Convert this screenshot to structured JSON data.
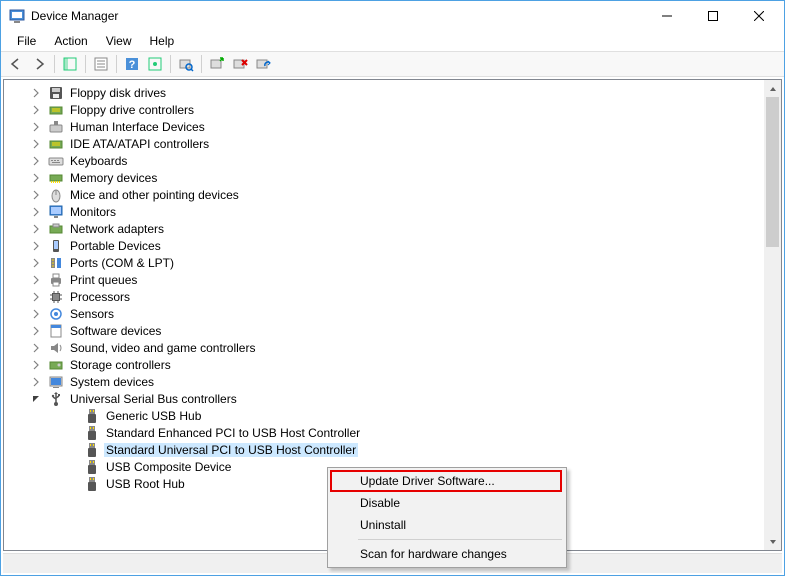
{
  "window": {
    "title": "Device Manager"
  },
  "menu": {
    "file": "File",
    "action": "Action",
    "view": "View",
    "help": "Help"
  },
  "tree": {
    "categories": [
      {
        "label": "Floppy disk drives",
        "expanded": false
      },
      {
        "label": "Floppy drive controllers",
        "expanded": false
      },
      {
        "label": "Human Interface Devices",
        "expanded": false
      },
      {
        "label": "IDE ATA/ATAPI controllers",
        "expanded": false
      },
      {
        "label": "Keyboards",
        "expanded": false
      },
      {
        "label": "Memory devices",
        "expanded": false
      },
      {
        "label": "Mice and other pointing devices",
        "expanded": false
      },
      {
        "label": "Monitors",
        "expanded": false
      },
      {
        "label": "Network adapters",
        "expanded": false
      },
      {
        "label": "Portable Devices",
        "expanded": false
      },
      {
        "label": "Ports (COM & LPT)",
        "expanded": false
      },
      {
        "label": "Print queues",
        "expanded": false
      },
      {
        "label": "Processors",
        "expanded": false
      },
      {
        "label": "Sensors",
        "expanded": false
      },
      {
        "label": "Software devices",
        "expanded": false
      },
      {
        "label": "Sound, video and game controllers",
        "expanded": false
      },
      {
        "label": "Storage controllers",
        "expanded": false
      },
      {
        "label": "System devices",
        "expanded": false
      },
      {
        "label": "Universal Serial Bus controllers",
        "expanded": true
      }
    ],
    "usb_children": [
      {
        "label": "Generic USB Hub"
      },
      {
        "label": "Standard Enhanced PCI to USB Host Controller"
      },
      {
        "label": "Standard Universal PCI to USB Host Controller",
        "selected": true
      },
      {
        "label": "USB Composite Device"
      },
      {
        "label": "USB Root Hub"
      }
    ]
  },
  "context": {
    "update": "Update Driver Software...",
    "disable": "Disable",
    "uninstall": "Uninstall",
    "scan": "Scan for hardware changes"
  }
}
